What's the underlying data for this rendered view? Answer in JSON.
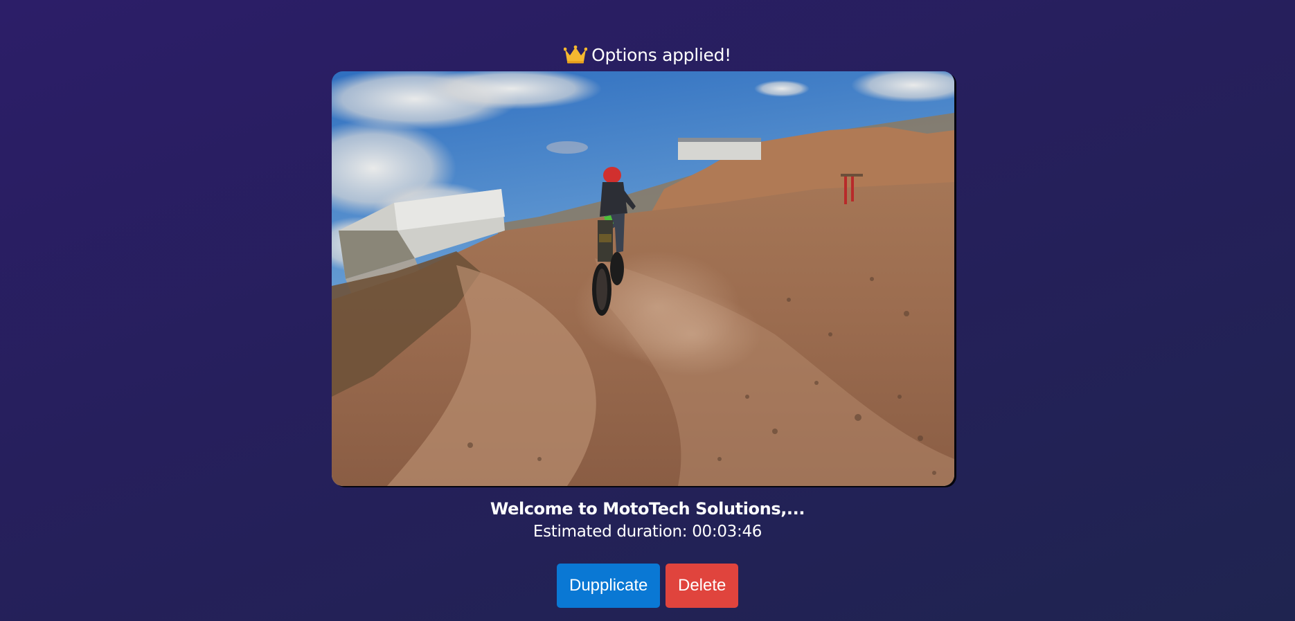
{
  "banner": {
    "icon": "crown-icon",
    "text": "Options applied!"
  },
  "video": {
    "thumbnail": "dirt-bike-rider-on-dirt-track"
  },
  "caption": {
    "title": "Welcome to MotoTech Solutions,...",
    "duration": "Estimated duration: 00:03:46"
  },
  "actions": {
    "duplicate_label": "Dupplicate",
    "delete_label": "Delete"
  },
  "colors": {
    "duplicate_button": "#0a78d4",
    "delete_button": "#e0443d",
    "crown": "#f5b830"
  }
}
